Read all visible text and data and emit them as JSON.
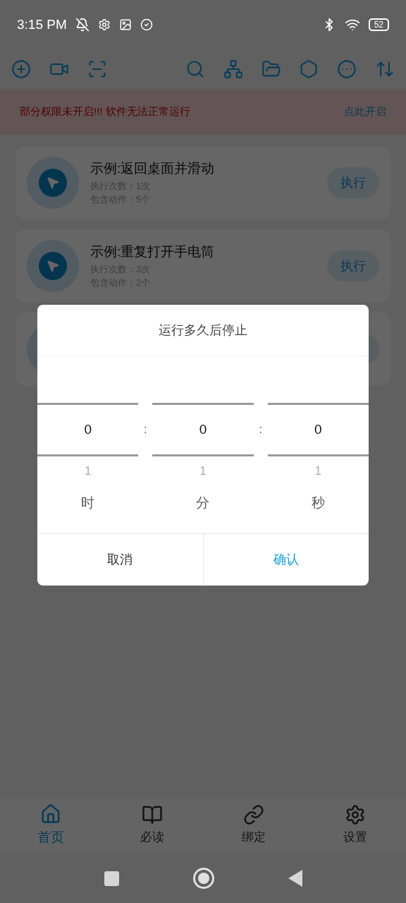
{
  "status_bar": {
    "time": "3:15 PM",
    "battery": "52"
  },
  "banner": {
    "message": "部分权限未开启!!! 软件无法正常运行",
    "action": "点此开启"
  },
  "cards": [
    {
      "kind": "task",
      "title": "示例:返回桌面并滑动",
      "runs": "执行次数：1次",
      "actions": "包含动作：5个",
      "button": "执行"
    },
    {
      "kind": "task",
      "title": "示例:重复打开手电筒",
      "runs": "执行次数：3次",
      "actions": "包含动作：2个",
      "button": "执行"
    },
    {
      "kind": "covered"
    }
  ],
  "dialog": {
    "title": "运行多久后停止",
    "columns": [
      {
        "value": "0",
        "next": "1",
        "unit": "时"
      },
      {
        "value": "0",
        "next": "1",
        "unit": "分"
      },
      {
        "value": "0",
        "next": "1",
        "unit": "秒"
      }
    ],
    "separators": [
      ":",
      ":"
    ],
    "buttons": [
      {
        "label": "取消",
        "primary": false
      },
      {
        "label": "确认",
        "primary": true
      }
    ]
  },
  "bottom_nav": [
    {
      "label": "首页",
      "selected": true
    },
    {
      "label": "必读",
      "selected": false
    },
    {
      "label": "绑定",
      "selected": false
    },
    {
      "label": "设置",
      "selected": false
    }
  ]
}
